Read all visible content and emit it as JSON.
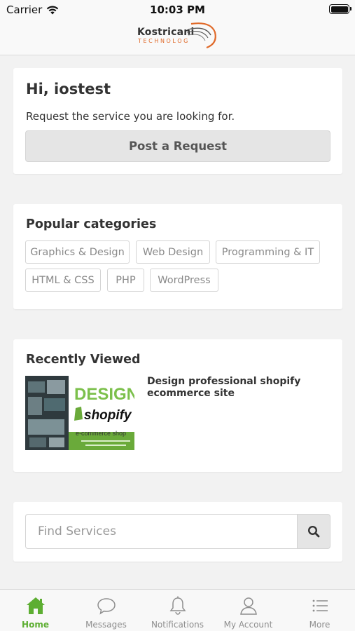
{
  "status_bar": {
    "carrier": "Carrier",
    "time": "10:03 PM"
  },
  "header": {
    "logo_name": "Kostricani",
    "logo_sub": "TECHNOLOG",
    "logo_color": "#e06a2a"
  },
  "greeting": {
    "title": "Hi, iostest",
    "subtitle": "Request the service you are looking for.",
    "button_label": "Post a Request"
  },
  "categories": {
    "title": "Popular categories",
    "items": [
      "Graphics & Design",
      "Web Design",
      "Programming & IT",
      "HTML & CSS",
      "PHP",
      "WordPress"
    ]
  },
  "recently_viewed": {
    "title": "Recently Viewed",
    "items": [
      {
        "name": "Design professional shopify ecommerce site",
        "thumb_headline": "DESIGN",
        "thumb_brand": "shopify",
        "thumb_tagline": "e-commerce shop"
      }
    ]
  },
  "search": {
    "placeholder": "Find Services",
    "icon": "search-icon"
  },
  "tab_bar": {
    "accent_color": "#5dae32",
    "items": [
      {
        "label": "Home",
        "icon": "home-icon",
        "active": true
      },
      {
        "label": "Messages",
        "icon": "chat-bubble-icon",
        "active": false
      },
      {
        "label": "Notifications",
        "icon": "bell-icon",
        "active": false
      },
      {
        "label": "My Account",
        "icon": "person-icon",
        "active": false
      },
      {
        "label": "More",
        "icon": "list-icon",
        "active": false
      }
    ]
  }
}
